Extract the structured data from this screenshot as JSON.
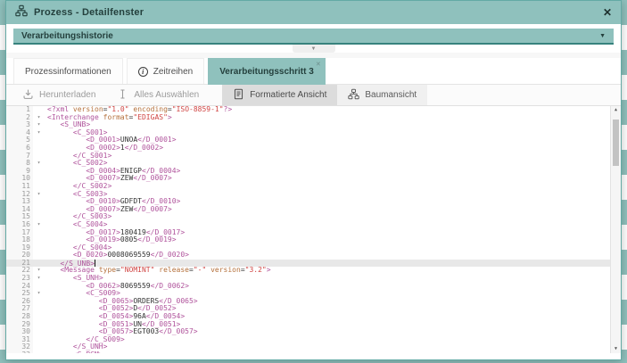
{
  "colors": {
    "accent_teal": "#8fc1bd",
    "accent_dark_teal": "#37827d",
    "active_line_bg": "#e8e8e8",
    "syntax_tag": "#b0549c",
    "syntax_attr": "#b5713c",
    "syntax_string": "#d04543",
    "syntax_text": "#333333"
  },
  "window": {
    "title": "Prozess - Detailfenster",
    "close_glyph": "✕"
  },
  "history": {
    "label": "Verarbeitungshistorie",
    "caret_glyph": "▼"
  },
  "collapse_handle": {
    "glyph": "▼"
  },
  "tabs": [
    {
      "label": "Prozessinformationen"
    },
    {
      "label": "Zeitreihen",
      "info_glyph": "i"
    },
    {
      "label": "Verarbeitungsschritt 3",
      "close_glyph": "✕"
    }
  ],
  "toolbar": {
    "download_label": "Herunterladen",
    "select_all_label": "Alles Auswählen",
    "formatted_view_label": "Formatierte Ansicht",
    "tree_view_label": "Baumansicht"
  },
  "editor": {
    "active_line": 21,
    "scroll_up_glyph": "▲",
    "scroll_down_glyph": "▼",
    "fold_glyph": "▾",
    "lines": [
      {
        "t": "<?xml version=\"1.0\" encoding=\"ISO-8859-1\"?>"
      },
      {
        "t": "<Interchange format=\"EDIGAS\">",
        "f": true
      },
      {
        "t": "   <S_UNB>",
        "f": true
      },
      {
        "t": "      <C_S001>",
        "f": true
      },
      {
        "t": "         <D_0001>UNOA</D_0001>"
      },
      {
        "t": "         <D_0002>1</D_0002>"
      },
      {
        "t": "      </C_S001>"
      },
      {
        "t": "      <C_S002>",
        "f": true
      },
      {
        "t": "         <D_0004>ENIGP</D_0004>"
      },
      {
        "t": "         <D_0007>ZEW</D_0007>"
      },
      {
        "t": "      </C_S002>"
      },
      {
        "t": "      <C_S003>",
        "f": true
      },
      {
        "t": "         <D_0010>GDFDT</D_0010>"
      },
      {
        "t": "         <D_0007>ZEW</D_0007>"
      },
      {
        "t": "      </C_S003>"
      },
      {
        "t": "      <C_S004>",
        "f": true
      },
      {
        "t": "         <D_0017>180419</D_0017>"
      },
      {
        "t": "         <D_0019>0805</D_0019>"
      },
      {
        "t": "      </C_S004>"
      },
      {
        "t": "      <D_0020>0008069559</D_0020>"
      },
      {
        "t": "   </S_UNB>"
      },
      {
        "t": "   <Message type=\"NOMINT\" release=\"-\" version=\"3.2\">",
        "f": true
      },
      {
        "t": "      <S_UNH>",
        "f": true
      },
      {
        "t": "         <D_0062>8069559</D_0062>"
      },
      {
        "t": "         <C_S009>",
        "f": true
      },
      {
        "t": "            <D_0065>ORDERS</D_0065>"
      },
      {
        "t": "            <D_0052>D</D_0052>"
      },
      {
        "t": "            <D_0054>96A</D_0054>"
      },
      {
        "t": "            <D_0051>UN</D_0051>"
      },
      {
        "t": "            <D_0057>EGT003</D_0057>"
      },
      {
        "t": "         </C_S009>"
      },
      {
        "t": "      </S_UNH>"
      },
      {
        "t": "      <S_BGM>",
        "f": true
      }
    ]
  }
}
